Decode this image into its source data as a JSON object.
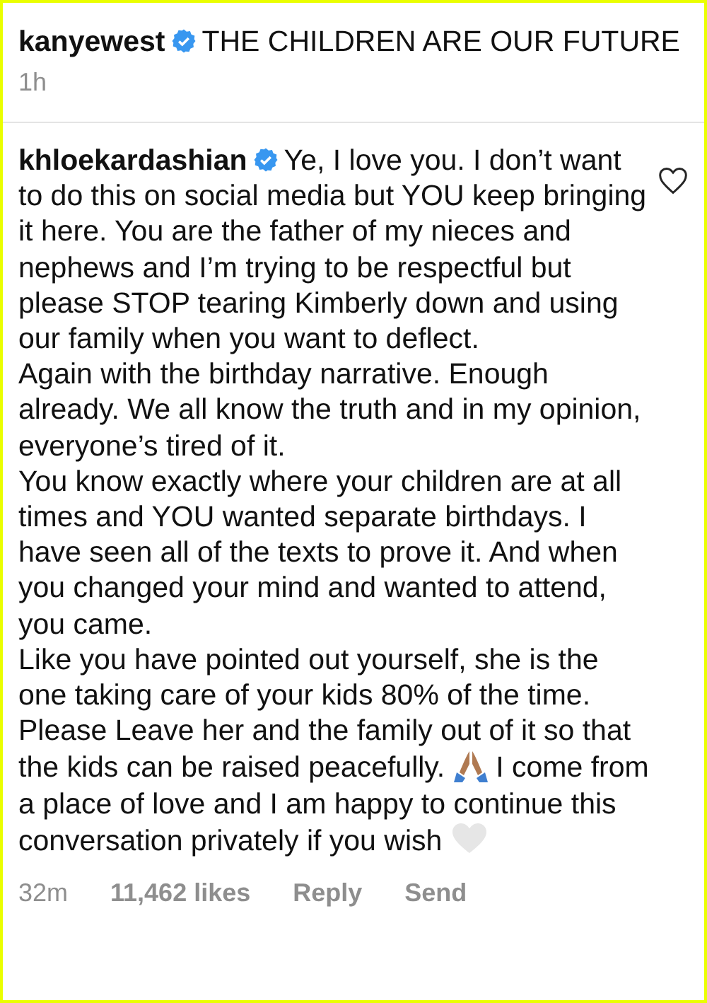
{
  "post": {
    "username": "kanyewest",
    "verified": true,
    "caption": "THE CHILDREN ARE OUR FUTURE",
    "time": "1h"
  },
  "comment": {
    "username": "khloekardashian",
    "verified": true,
    "liked": false,
    "paragraphs": [
      [
        {
          "kind": "text",
          "text": "Ye, I love you. I don’t want to do this on social media but YOU keep bringing it here. You are the father of my nieces and nephews and I’m trying to be respectful but please STOP tearing Kimberly down and using our family when you want to deflect."
        }
      ],
      [
        {
          "kind": "text",
          "text": "Again with the birthday narrative. Enough already. We all know the truth and in my opinion, everyone’s tired of it."
        }
      ],
      [
        {
          "kind": "text",
          "text": "You know exactly where your children are at all times and YOU wanted separate birthdays. I have seen all of the texts to prove it. And when you changed your mind and wanted to attend, you came."
        }
      ],
      [
        {
          "kind": "text",
          "text": "Like you have pointed out yourself, she is the one taking care of your kids 80% of the time. Please Leave her and the family out of it so that the kids can be raised peacefully."
        },
        {
          "kind": "praying-hands"
        },
        {
          "kind": "text",
          "text": "I come from a place of love and I am happy to continue this conversation privately if you wish"
        },
        {
          "kind": "white-heart"
        }
      ]
    ],
    "time": "32m",
    "likes": "11,462 likes",
    "actions": [
      "Reply",
      "Send"
    ]
  }
}
